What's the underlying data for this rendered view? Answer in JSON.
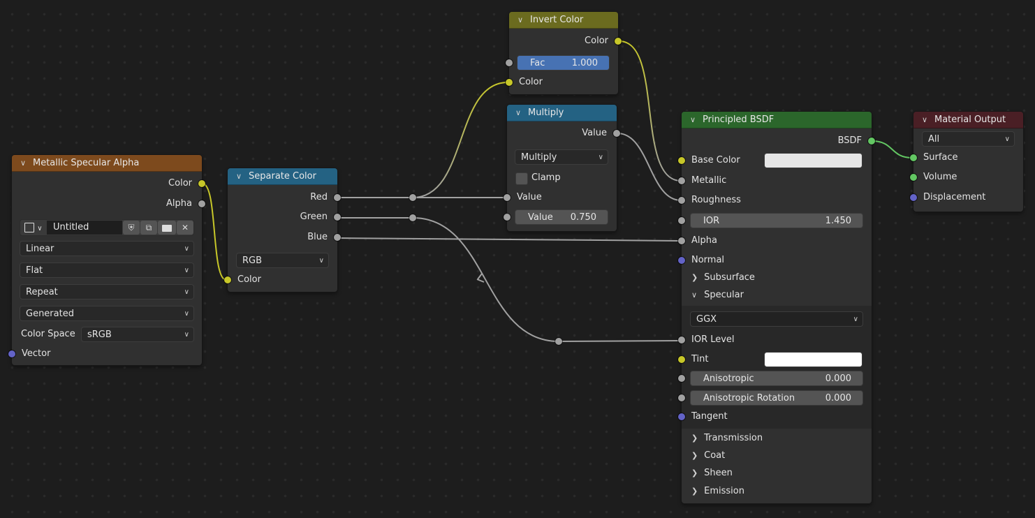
{
  "colors": {
    "background": "#1d1d1d",
    "node_body": "#303030",
    "socket_color": "#c7c729",
    "socket_float": "#a1a1a1",
    "socket_vector": "#6363c7",
    "socket_shader": "#63c763",
    "header_image_texture": "#7d4a1d",
    "header_converter": "#246283",
    "header_color": "#6b6b1f",
    "header_shader": "#2b662b",
    "header_output": "#4a1f25",
    "field_highlight": "#4772b3",
    "base_color_swatch": "#e6e6e6",
    "tint_swatch": "#ffffff"
  },
  "nodes": {
    "image_texture": {
      "title": "Metallic Specular Alpha",
      "outputs": [
        "Color",
        "Alpha"
      ],
      "image_name": "Untitled",
      "image_icons": [
        "image-browse-icon",
        "fake-user-shield-icon",
        "duplicate-icon",
        "open-folder-icon",
        "unlink-x-icon"
      ],
      "interpolation": "Linear",
      "projection": "Flat",
      "extension": "Repeat",
      "source": "Generated",
      "color_space_label": "Color Space",
      "color_space": "sRGB",
      "inputs": [
        "Vector"
      ]
    },
    "separate_color": {
      "title": "Separate Color",
      "outputs": [
        "Red",
        "Green",
        "Blue"
      ],
      "mode": "RGB",
      "inputs": [
        "Color"
      ]
    },
    "invert_color": {
      "title": "Invert Color",
      "outputs": [
        "Color"
      ],
      "fac_label": "Fac",
      "fac_value": "1.000",
      "inputs": [
        "Color"
      ]
    },
    "multiply": {
      "title": "Multiply",
      "outputs": [
        "Value"
      ],
      "operation": "Multiply",
      "clamp_label": "Clamp",
      "clamp_checked": false,
      "input_value_label": "Value",
      "value_field_label": "Value",
      "value_field_value": "0.750"
    },
    "principled_bsdf": {
      "title": "Principled BSDF",
      "outputs": [
        "BSDF"
      ],
      "base_color_label": "Base Color",
      "metallic_label": "Metallic",
      "roughness_label": "Roughness",
      "ior_label": "IOR",
      "ior_value": "1.450",
      "alpha_label": "Alpha",
      "normal_label": "Normal",
      "panels_collapsed_top": [
        "Subsurface"
      ],
      "specular_panel": "Specular",
      "distribution": "GGX",
      "ior_level_label": "IOR Level",
      "tint_label": "Tint",
      "anisotropic_label": "Anisotropic",
      "anisotropic_value": "0.000",
      "aniso_rot_label": "Anisotropic Rotation",
      "aniso_rot_value": "0.000",
      "tangent_label": "Tangent",
      "panels_collapsed_bottom": [
        "Transmission",
        "Coat",
        "Sheen",
        "Emission"
      ]
    },
    "material_output": {
      "title": "Material Output",
      "target": "All",
      "inputs": [
        "Surface",
        "Volume",
        "Displacement"
      ]
    }
  }
}
